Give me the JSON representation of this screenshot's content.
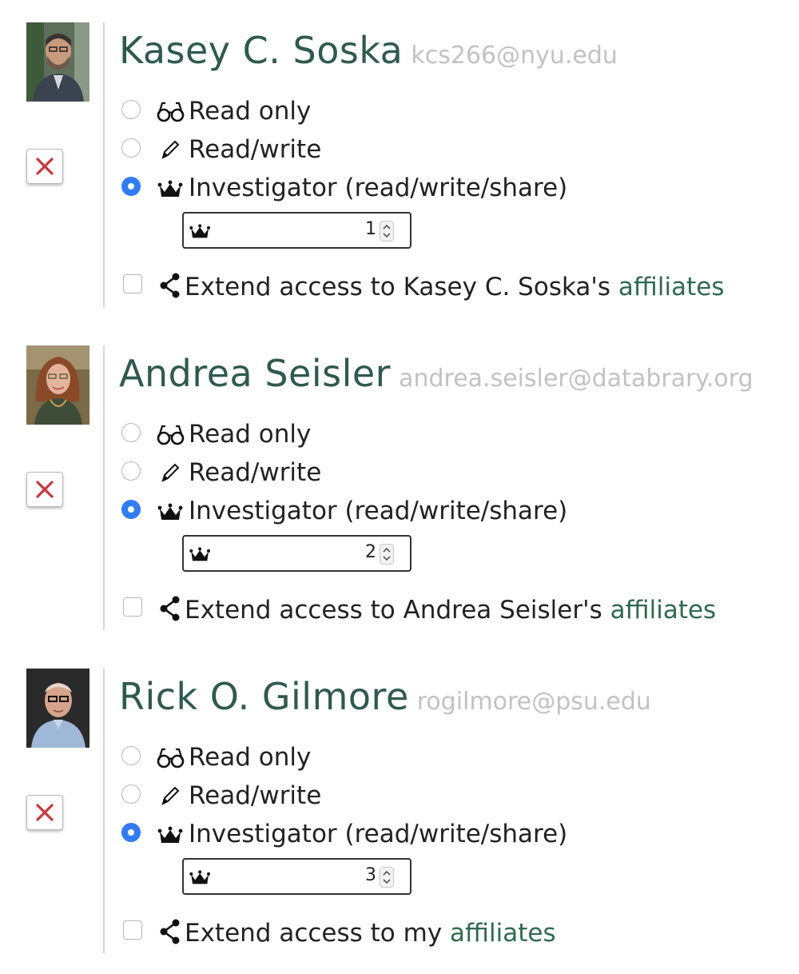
{
  "parties": [
    {
      "name": "Kasey C. Soska",
      "email": "kcs266@nyu.edu",
      "options": [
        {
          "label": "Read only",
          "icon": "glasses-icon",
          "checked": false
        },
        {
          "label": "Read/write",
          "icon": "pencil-icon",
          "checked": false
        },
        {
          "label": "Investigator (read/write/share)",
          "icon": "crown-icon",
          "checked": true
        }
      ],
      "expiration_value": "1",
      "extend_text": "Extend access to Kasey C. Soska's ",
      "extend_link": "affiliates"
    },
    {
      "name": "Andrea Seisler",
      "email": "andrea.seisler@databrary.org",
      "options": [
        {
          "label": "Read only",
          "icon": "glasses-icon",
          "checked": false
        },
        {
          "label": "Read/write",
          "icon": "pencil-icon",
          "checked": false
        },
        {
          "label": "Investigator (read/write/share)",
          "icon": "crown-icon",
          "checked": true
        }
      ],
      "expiration_value": "2",
      "extend_text": "Extend access to Andrea Seisler's ",
      "extend_link": "affiliates"
    },
    {
      "name": "Rick O. Gilmore",
      "email": "rogilmore@psu.edu",
      "options": [
        {
          "label": "Read only",
          "icon": "glasses-icon",
          "checked": false
        },
        {
          "label": "Read/write",
          "icon": "pencil-icon",
          "checked": false
        },
        {
          "label": "Investigator (read/write/share)",
          "icon": "crown-icon",
          "checked": true
        }
      ],
      "expiration_value": "3",
      "extend_text": "Extend access to my ",
      "extend_link": "affiliates"
    }
  ],
  "colors": {
    "name": "#2f5a4e",
    "email": "#c2c2c2",
    "link": "#2f6a4f",
    "radio_checked": "#2f7cf6",
    "delete_x": "#c8373a"
  }
}
